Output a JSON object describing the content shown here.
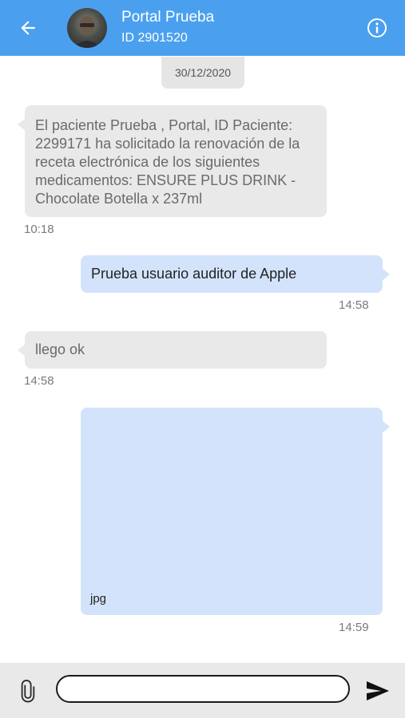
{
  "header": {
    "title": "Portal Prueba",
    "subtitle": "ID 2901520"
  },
  "date_chip": "30/12/2020",
  "messages": [
    {
      "direction": "incoming",
      "text": "El paciente Prueba , Portal, ID Paciente: 2299171 ha solicitado la renovación de la receta electrónica de los siguientes medicamentos: ENSURE PLUS DRINK - Chocolate Botella x 237ml",
      "time": "10:18"
    },
    {
      "direction": "outgoing",
      "text": "Prueba usuario auditor de Apple",
      "time": "14:58"
    },
    {
      "direction": "incoming",
      "text": "llego ok",
      "time": "14:58"
    },
    {
      "direction": "outgoing",
      "attachment_label": "jpg",
      "time": "14:59"
    }
  ],
  "composer": {
    "value": "",
    "attach_icon": "paperclip-icon",
    "send_icon": "send-icon"
  },
  "colors": {
    "header": "#4aa0ef",
    "incoming_bubble": "#e9e9e9",
    "outgoing_bubble": "#d3e3fb",
    "composer_bar": "#e9e9e9"
  }
}
